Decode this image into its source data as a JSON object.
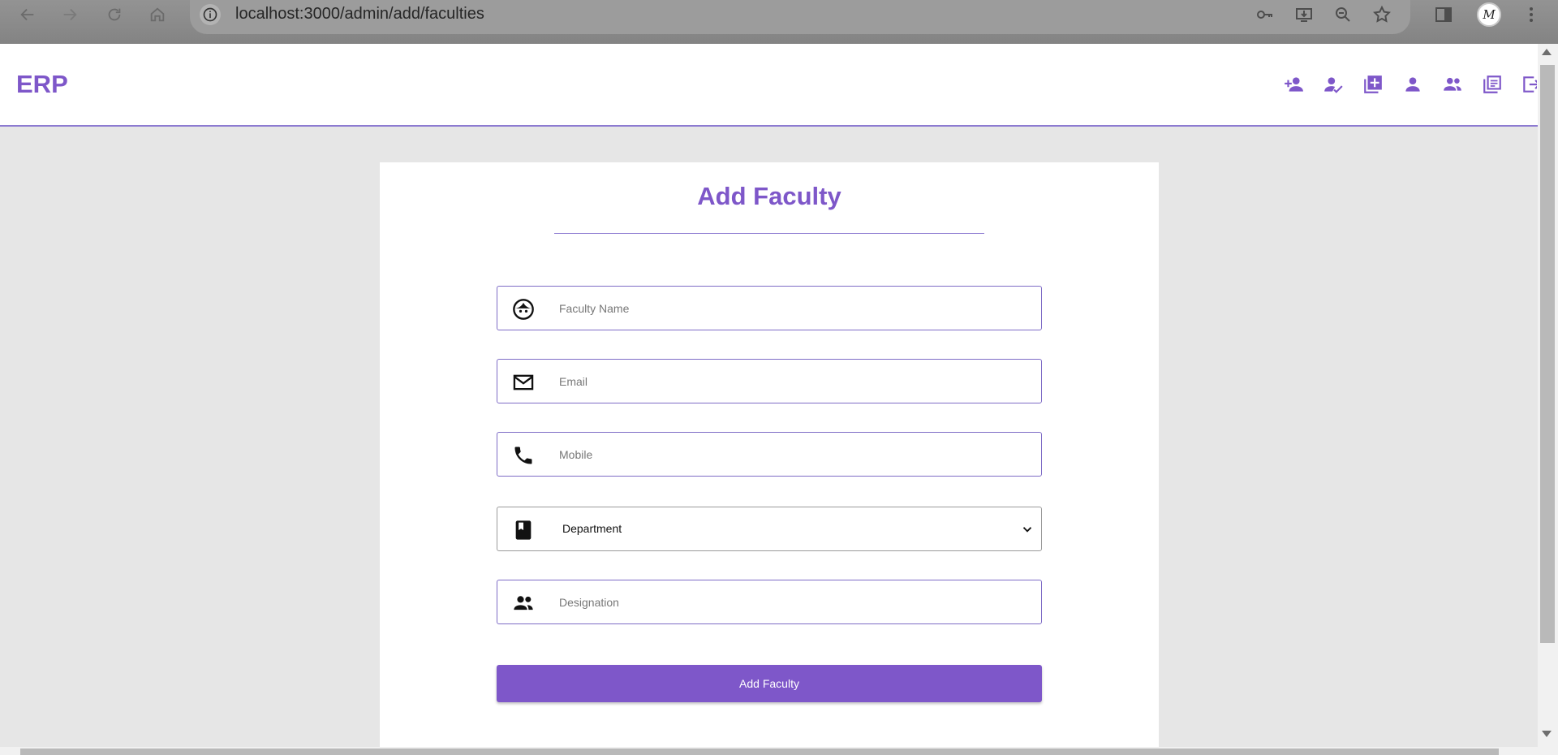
{
  "browser": {
    "url": "localhost:3000/admin/add/faculties",
    "profile_initials": "M"
  },
  "app": {
    "logo": "ERP",
    "nav_icons": [
      "add-student-icon",
      "assign-teacher-icon",
      "add-course-icon",
      "profile-icon",
      "faculties-icon",
      "notes-icon",
      "logout-icon"
    ]
  },
  "form": {
    "title": "Add Faculty",
    "fields": {
      "name_placeholder": "Faculty Name",
      "email_placeholder": "Email",
      "mobile_placeholder": "Mobile",
      "department_value": "Department",
      "designation_placeholder": "Designation"
    },
    "submit_label": "Add Faculty"
  },
  "colors": {
    "accent": "#7e57c9",
    "border": "#7e6cc6",
    "page_bg": "#e6e6e6"
  }
}
